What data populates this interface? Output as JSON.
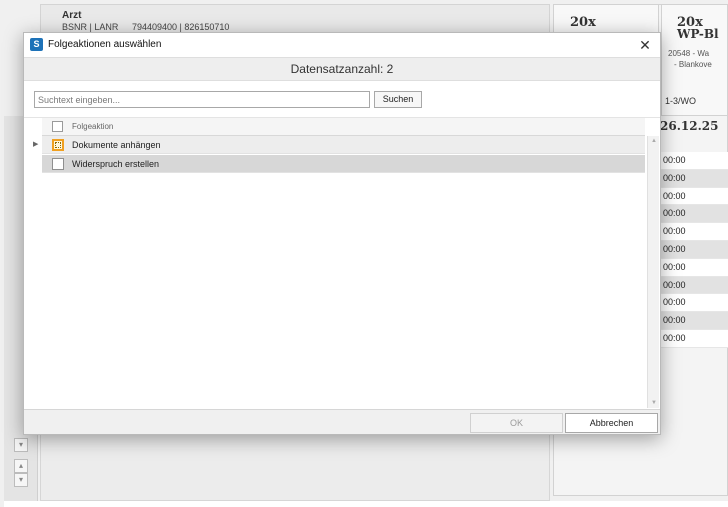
{
  "background": {
    "arzt_label": "Arzt",
    "bsnr_label": "BSNR | LANR",
    "bsnr_value": "794409400 | 826150710",
    "tile_a": {
      "head": "20x"
    },
    "tile_b": {
      "head": "20x",
      "sub": "WP-Bl",
      "line1": "20548 - Wa",
      "line2": "- Blankove"
    },
    "period_note": "1-3/WO",
    "date_head": "26.12.25",
    "times": [
      "00:00",
      "00:00",
      "00:00",
      "00:00",
      "00:00",
      "00:00",
      "00:00",
      "00:00",
      "00:00",
      "00:00",
      "00:00"
    ]
  },
  "dialog": {
    "app_icon_letter": "S",
    "title": "Folgeaktionen auswählen",
    "close_glyph": "✕",
    "record_count": "Datensatzanzahl: 2",
    "search": {
      "placeholder": "Suchtext eingeben...",
      "value": "",
      "button_label": "Suchen"
    },
    "grid": {
      "column_header": "Folgeaktion",
      "rows": [
        {
          "label": "Dokumente anhängen",
          "checked": false,
          "focused": true
        },
        {
          "label": "Widerspruch erstellen",
          "checked": false,
          "focused": false
        }
      ]
    },
    "footer": {
      "ok_label": "OK",
      "ok_enabled": false,
      "cancel_label": "Abbrechen"
    }
  }
}
